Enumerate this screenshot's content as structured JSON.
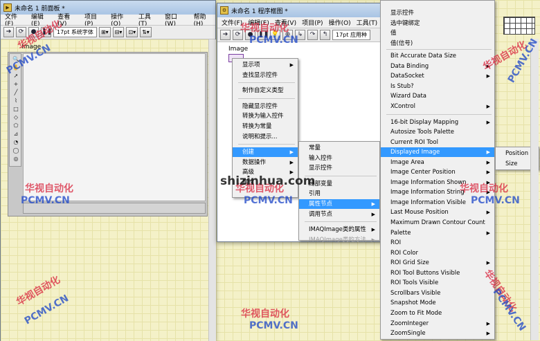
{
  "front_panel": {
    "title": "未命名 1 前面板 *",
    "menu": [
      "文件(F)",
      "编辑(E)",
      "查看(V)",
      "项目(P)",
      "操作(O)",
      "工具(T)",
      "窗口(W)",
      "帮助(H)"
    ],
    "font": "17pt 系统字体",
    "control_label": "Image"
  },
  "block_diagram": {
    "title": "未命名 1 程序框图 *",
    "menu": [
      "文件(F)",
      "编辑(E)",
      "查看(V)",
      "项目(P)",
      "操作(O)",
      "工具(T)"
    ],
    "font": "17pt 应用种",
    "terminal_label": "Image"
  },
  "context_menu": {
    "items": [
      {
        "label": "显示项",
        "submenu": true
      },
      {
        "label": "查找显示控件"
      },
      {
        "label": "制作自定义类型"
      },
      {
        "label": "隐藏显示控件"
      },
      {
        "label": "转换为输入控件"
      },
      {
        "label": "转换为常量"
      },
      {
        "label": "说明和提示..."
      },
      {
        "label": "创建",
        "submenu": true,
        "highlighted": true
      },
      {
        "label": "数据操作",
        "submenu": true
      },
      {
        "label": "高级",
        "submenu": true
      },
      {
        "label": "属性",
        "submenu": false
      }
    ]
  },
  "create_submenu": {
    "items": [
      {
        "label": "常量"
      },
      {
        "label": "输入控件"
      },
      {
        "label": "显示控件"
      },
      {
        "label": "局部变量"
      },
      {
        "label": "引用"
      },
      {
        "label": "属性节点",
        "submenu": true,
        "highlighted": true
      },
      {
        "label": "调用节点",
        "submenu": true
      },
      {
        "label": "IMAQImage类的属性",
        "submenu": true
      },
      {
        "label": "IMAQImage类的方法",
        "submenu": true,
        "disabled": true
      }
    ]
  },
  "property_menu": {
    "items": [
      {
        "label": "显示控件"
      },
      {
        "label": "选中键绑定"
      },
      {
        "label": "值"
      },
      {
        "label": "值(信号)"
      },
      {
        "label": "Bit Accurate Data Size"
      },
      {
        "label": "Data Binding",
        "submenu": true
      },
      {
        "label": "DataSocket",
        "submenu": true
      },
      {
        "label": "Is Stub?"
      },
      {
        "label": "Wizard Data"
      },
      {
        "label": "XControl",
        "submenu": true
      },
      {
        "label": "16-bit Display Mapping",
        "submenu": true
      },
      {
        "label": "Autosize Tools Palette"
      },
      {
        "label": "Current ROI Tool"
      },
      {
        "label": "Displayed Image",
        "submenu": true,
        "highlighted": true
      },
      {
        "label": "Image Area",
        "submenu": true
      },
      {
        "label": "Image Center Position",
        "submenu": true
      },
      {
        "label": "Image Information Shown",
        "submenu": true
      },
      {
        "label": "Image Information String",
        "submenu": true
      },
      {
        "label": "Image Information Visible"
      },
      {
        "label": "Last Mouse Position",
        "submenu": true
      },
      {
        "label": "Maximum Drawn Contour Count"
      },
      {
        "label": "Palette",
        "submenu": true
      },
      {
        "label": "ROI"
      },
      {
        "label": "ROI Color"
      },
      {
        "label": "ROI Grid Size",
        "submenu": true
      },
      {
        "label": "ROI Tool Buttons Visible"
      },
      {
        "label": "ROI Tools Visible"
      },
      {
        "label": "Scrollbars Visible"
      },
      {
        "label": "Snapshot Mode"
      },
      {
        "label": "Zoom to Fit Mode"
      },
      {
        "label": "ZoomInteger",
        "submenu": true
      },
      {
        "label": "ZoomSingle",
        "submenu": true
      }
    ]
  },
  "displayed_image_submenu": {
    "items": [
      {
        "label": "Position",
        "submenu": true
      },
      {
        "label": "Size",
        "submenu": true
      }
    ]
  },
  "watermarks": {
    "cn": "华视自动化",
    "en": "PCMV.CN",
    "site": "shizinhua.com"
  },
  "colors": {
    "highlight": "#3399ff",
    "watermark_red": "#d9243c",
    "watermark_blue": "#1b45c8"
  }
}
